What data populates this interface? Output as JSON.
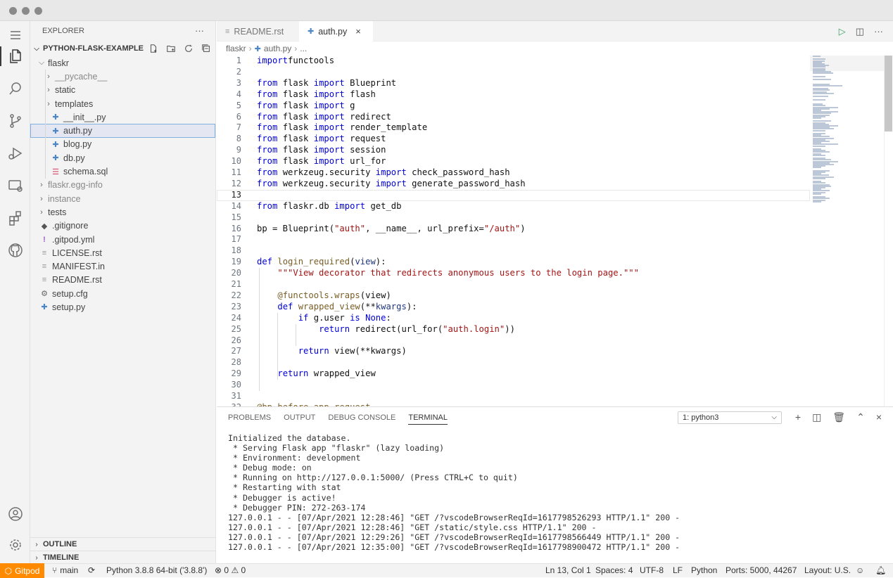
{
  "sidebar": {
    "title": "EXPLORER",
    "project": "PYTHON-FLASK-EXAMPLE",
    "tree": [
      {
        "label": "flaskr",
        "type": "folder-open",
        "depth": 0,
        "dim": false
      },
      {
        "label": "__pycache__",
        "type": "folder",
        "depth": 1,
        "dim": true
      },
      {
        "label": "static",
        "type": "folder",
        "depth": 1,
        "dim": false
      },
      {
        "label": "templates",
        "type": "folder",
        "depth": 1,
        "dim": false
      },
      {
        "label": "__init__.py",
        "type": "py",
        "depth": 1,
        "dim": false
      },
      {
        "label": "auth.py",
        "type": "py",
        "depth": 1,
        "dim": false,
        "selected": true
      },
      {
        "label": "blog.py",
        "type": "py",
        "depth": 1,
        "dim": false
      },
      {
        "label": "db.py",
        "type": "py",
        "depth": 1,
        "dim": false
      },
      {
        "label": "schema.sql",
        "type": "sql",
        "depth": 1,
        "dim": false
      },
      {
        "label": "flaskr.egg-info",
        "type": "folder",
        "depth": 0,
        "dim": true
      },
      {
        "label": "instance",
        "type": "folder",
        "depth": 0,
        "dim": true
      },
      {
        "label": "tests",
        "type": "folder",
        "depth": 0,
        "dim": false
      },
      {
        "label": ".gitignore",
        "type": "git",
        "depth": 0,
        "dim": false
      },
      {
        "label": ".gitpod.yml",
        "type": "yml",
        "depth": 0,
        "dim": false
      },
      {
        "label": "LICENSE.rst",
        "type": "txt",
        "depth": 0,
        "dim": false
      },
      {
        "label": "MANIFEST.in",
        "type": "txt",
        "depth": 0,
        "dim": false
      },
      {
        "label": "README.rst",
        "type": "txt",
        "depth": 0,
        "dim": false
      },
      {
        "label": "setup.cfg",
        "type": "gear",
        "depth": 0,
        "dim": false
      },
      {
        "label": "setup.py",
        "type": "py",
        "depth": 0,
        "dim": false
      }
    ],
    "outline_label": "OUTLINE",
    "timeline_label": "TIMELINE"
  },
  "tabs": [
    {
      "label": "README.rst",
      "icon": "≡",
      "active": false
    },
    {
      "label": "auth.py",
      "icon": "✚",
      "active": true,
      "close": "×"
    }
  ],
  "breadcrumb": {
    "folder": "flaskr",
    "file": "auth.py",
    "tail": "..."
  },
  "editor": {
    "current_line": 13,
    "lines": [
      [
        [
          "kw",
          "import"
        ],
        [
          "",
          "functools"
        ]
      ],
      [],
      [
        [
          "kw",
          "from"
        ],
        [
          "",
          " flask "
        ],
        [
          "kw",
          "import"
        ],
        [
          "",
          " Blueprint"
        ]
      ],
      [
        [
          "kw",
          "from"
        ],
        [
          "",
          " flask "
        ],
        [
          "kw",
          "import"
        ],
        [
          "",
          " flash"
        ]
      ],
      [
        [
          "kw",
          "from"
        ],
        [
          "",
          " flask "
        ],
        [
          "kw",
          "import"
        ],
        [
          "",
          " g"
        ]
      ],
      [
        [
          "kw",
          "from"
        ],
        [
          "",
          " flask "
        ],
        [
          "kw",
          "import"
        ],
        [
          "",
          " redirect"
        ]
      ],
      [
        [
          "kw",
          "from"
        ],
        [
          "",
          " flask "
        ],
        [
          "kw",
          "import"
        ],
        [
          "",
          " render_template"
        ]
      ],
      [
        [
          "kw",
          "from"
        ],
        [
          "",
          " flask "
        ],
        [
          "kw",
          "import"
        ],
        [
          "",
          " request"
        ]
      ],
      [
        [
          "kw",
          "from"
        ],
        [
          "",
          " flask "
        ],
        [
          "kw",
          "import"
        ],
        [
          "",
          " session"
        ]
      ],
      [
        [
          "kw",
          "from"
        ],
        [
          "",
          " flask "
        ],
        [
          "kw",
          "import"
        ],
        [
          "",
          " url_for"
        ]
      ],
      [
        [
          "kw",
          "from"
        ],
        [
          "",
          " werkzeug.security "
        ],
        [
          "kw",
          "import"
        ],
        [
          "",
          " check_password_hash"
        ]
      ],
      [
        [
          "kw",
          "from"
        ],
        [
          "",
          " werkzeug.security "
        ],
        [
          "kw",
          "import"
        ],
        [
          "",
          " generate_password_hash"
        ]
      ],
      [],
      [
        [
          "kw",
          "from"
        ],
        [
          "",
          " flaskr.db "
        ],
        [
          "kw",
          "import"
        ],
        [
          "",
          " get_db"
        ]
      ],
      [],
      [
        [
          "",
          "bp = Blueprint("
        ],
        [
          "str",
          "\"auth\""
        ],
        [
          "",
          ", __name__, url_prefix="
        ],
        [
          "str",
          "\"/auth\""
        ],
        [
          "",
          ")"
        ]
      ],
      [],
      [],
      [
        [
          "kw",
          "def"
        ],
        [
          "",
          " "
        ],
        [
          "fn",
          "login_required"
        ],
        [
          "",
          "("
        ],
        [
          "pm",
          "view"
        ],
        [
          "",
          "):"
        ]
      ],
      [
        [
          "",
          "    "
        ],
        [
          "str",
          "\"\"\"View decorator that redirects anonymous users to the login page.\"\"\""
        ]
      ],
      [],
      [
        [
          "",
          "    "
        ],
        [
          "dec",
          "@functools.wraps"
        ],
        [
          "",
          "(view)"
        ]
      ],
      [
        [
          "",
          "    "
        ],
        [
          "kw",
          "def"
        ],
        [
          "",
          " "
        ],
        [
          "fn",
          "wrapped_view"
        ],
        [
          "",
          "(**"
        ],
        [
          "pm",
          "kwargs"
        ],
        [
          "",
          "):"
        ]
      ],
      [
        [
          "",
          "        "
        ],
        [
          "kw",
          "if"
        ],
        [
          "",
          " g.user "
        ],
        [
          "kw",
          "is"
        ],
        [
          "",
          " "
        ],
        [
          "kw",
          "None"
        ],
        [
          "",
          ":"
        ]
      ],
      [
        [
          "",
          "            "
        ],
        [
          "kw",
          "return"
        ],
        [
          "",
          " redirect(url_for("
        ],
        [
          "str",
          "\"auth.login\""
        ],
        [
          "",
          "))"
        ]
      ],
      [],
      [
        [
          "",
          "        "
        ],
        [
          "kw",
          "return"
        ],
        [
          "",
          " view(**kwargs)"
        ]
      ],
      [],
      [
        [
          "",
          "    "
        ],
        [
          "kw",
          "return"
        ],
        [
          "",
          " wrapped_view"
        ]
      ],
      [],
      [],
      [
        [
          "dec",
          "@bp.before_app_request"
        ]
      ]
    ]
  },
  "panel": {
    "tabs": [
      "PROBLEMS",
      "OUTPUT",
      "DEBUG CONSOLE",
      "TERMINAL"
    ],
    "active_tab": "TERMINAL",
    "terminal_select": "1: python3",
    "terminal_lines": [
      "Initialized the database.",
      " * Serving Flask app \"flaskr\" (lazy loading)",
      " * Environment: development",
      " * Debug mode: on",
      " * Running on http://127.0.0.1:5000/ (Press CTRL+C to quit)",
      " * Restarting with stat",
      " * Debugger is active!",
      " * Debugger PIN: 272-263-174",
      "127.0.0.1 - - [07/Apr/2021 12:28:46] \"GET /?vscodeBrowserReqId=1617798526293 HTTP/1.1\" 200 -",
      "127.0.0.1 - - [07/Apr/2021 12:28:46] \"GET /static/style.css HTTP/1.1\" 200 -",
      "127.0.0.1 - - [07/Apr/2021 12:29:26] \"GET /?vscodeBrowserReqId=1617798566449 HTTP/1.1\" 200 -",
      "127.0.0.1 - - [07/Apr/2021 12:35:00] \"GET /?vscodeBrowserReqId=1617798900472 HTTP/1.1\" 200 -"
    ]
  },
  "status": {
    "remote": "Gitpod",
    "branch": "main",
    "python": "Python 3.8.8 64-bit ('3.8.8')",
    "problems": "0",
    "warnings": "0",
    "position": "Ln 13, Col 1",
    "spaces": "Spaces: 4",
    "encoding": "UTF-8",
    "eol": "LF",
    "language": "Python",
    "ports": "Ports: 5000, 44267",
    "layout": "Layout: U.S."
  },
  "colors": {
    "remote": "#ff8a00",
    "keyword": "#0000d6",
    "string": "#a31515",
    "function": "#795e26"
  }
}
